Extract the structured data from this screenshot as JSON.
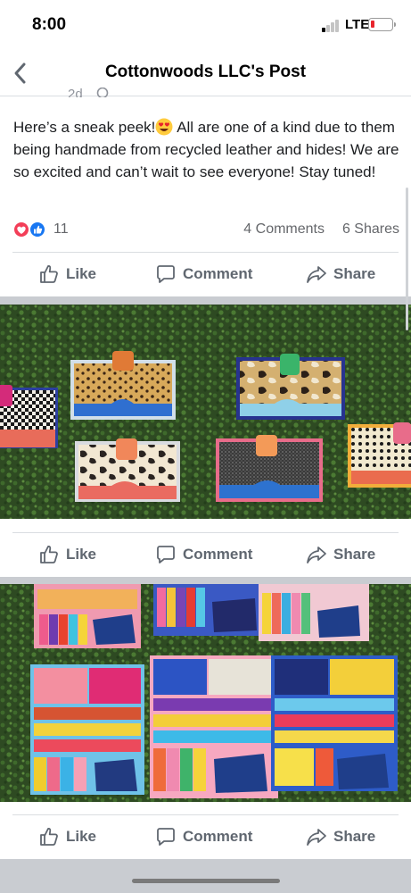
{
  "status_bar": {
    "time": "8:00",
    "network": "LTE",
    "battery_icon": "battery-low-icon"
  },
  "nav": {
    "title": "Cottonwoods LLC's Post",
    "back_icon": "chevron-left-icon"
  },
  "post": {
    "time_fragment": "2d",
    "text_before_emoji": "Here’s a sneak peek!",
    "emoji": "heart-eyes-emoji",
    "text_after_emoji": " All are one of a kind due to them being handmade from recycled leather and hides! We are so excited and can’t wait to see everyone! Stay tuned!",
    "reaction_icons": [
      "love-reaction-icon",
      "like-reaction-icon"
    ],
    "reaction_count": "11",
    "comments": "4 Comments",
    "shares": "6 Shares"
  },
  "actions": {
    "like": "Like",
    "comment": "Comment",
    "share": "Share"
  },
  "colors": {
    "text": "#1c1e21",
    "muted": "#65676b",
    "action": "#606770",
    "divider": "#dadde1",
    "separator": "#c9ccd1",
    "like_blue": "#1877f2",
    "love_red": "#f33e58",
    "hedge_green": "#2e4a22"
  }
}
